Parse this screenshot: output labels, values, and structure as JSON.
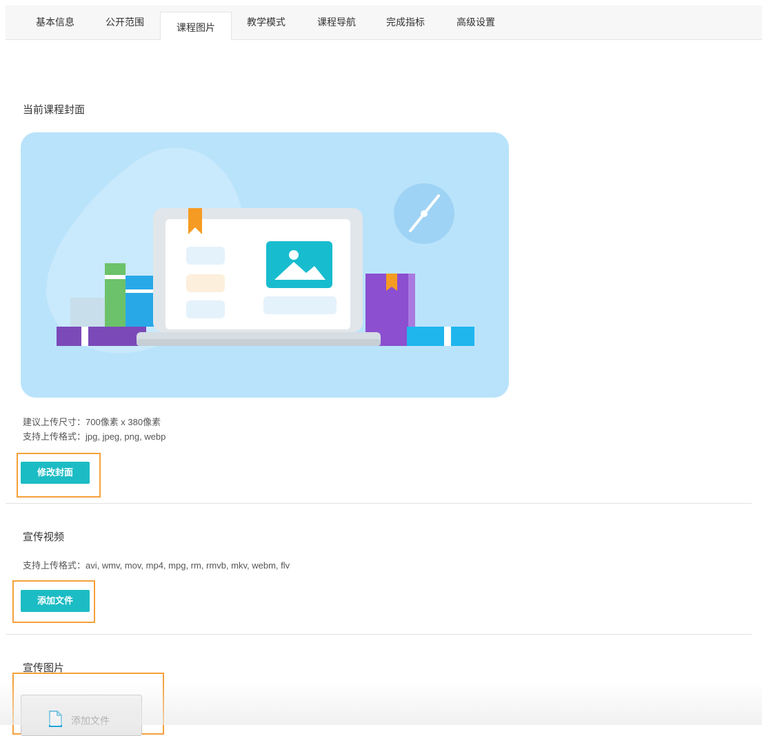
{
  "tabs": [
    {
      "label": "基本信息"
    },
    {
      "label": "公开范围"
    },
    {
      "label": "课程图片"
    },
    {
      "label": "教学模式"
    },
    {
      "label": "课程导航"
    },
    {
      "label": "完成指标"
    },
    {
      "label": "高级设置"
    }
  ],
  "active_tab": "课程图片",
  "cover": {
    "title": "当前课程封面",
    "size_hint": "建议上传尺寸：700像素 x 380像素",
    "format_hint": "支持上传格式：jpg, jpeg, png, webp",
    "change_button": "修改封面"
  },
  "video": {
    "title": "宣传视频",
    "format_hint": "支持上传格式：avi, wmv, mov, mp4, mpg, rm, rmvb, mkv, webm, flv",
    "add_button": "添加文件"
  },
  "images": {
    "title": "宣传图片",
    "add_tile_label": "添加文件"
  },
  "colors": {
    "accent": "#1cbcc4",
    "highlight": "#f5a03a",
    "cover_bg": "#b9e3fb"
  },
  "icons": [
    "file-add-icon",
    "image-icon",
    "bookmark-icon",
    "compass-icon"
  ]
}
